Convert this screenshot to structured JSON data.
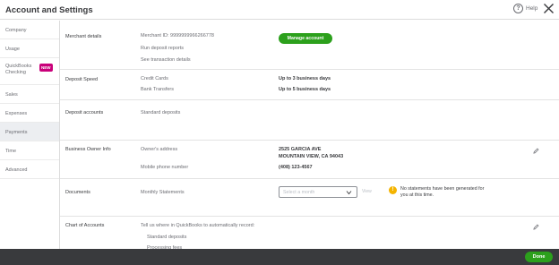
{
  "header": {
    "title": "Account and Settings",
    "help_label": "Help"
  },
  "sidebar": {
    "items": [
      {
        "label": "Company"
      },
      {
        "label": "Usage"
      },
      {
        "label": "QuickBooks Checking",
        "badge": "NEW"
      },
      {
        "label": "Sales"
      },
      {
        "label": "Expenses"
      },
      {
        "label": "Payments",
        "active": true
      },
      {
        "label": "Time"
      },
      {
        "label": "Advanced"
      }
    ]
  },
  "sections": {
    "merchant": {
      "title": "Merchant details",
      "merchant_id": "Merchant ID: 9999999966266778",
      "run_reports": "Run deposit reports",
      "see_details": "See transaction details",
      "manage_label": "Manage account"
    },
    "deposit_speed": {
      "title": "Deposit Speed",
      "rows": [
        {
          "label": "Credit Cards",
          "value": "Up to 3 business days"
        },
        {
          "label": "Bank Transfers",
          "value": "Up to 5 business days"
        }
      ]
    },
    "deposit_accounts": {
      "title": "Deposit accounts",
      "label": "Standard deposits"
    },
    "owner": {
      "title": "Business Owner Info",
      "address_label": "Owner's address",
      "address_line1": "2525 GARCIA AVE",
      "address_line2": "MOUNTAIN VIEW, CA 94043",
      "phone_label": "Mobile phone number",
      "phone": "(408) 123-4567"
    },
    "documents": {
      "title": "Documents",
      "label": "Monthly Statements",
      "select_placeholder": "Select a month",
      "view_label": "View",
      "notice": "No statements have been generated for you at this time."
    },
    "chart_accounts": {
      "title": "Chart of Accounts",
      "intro": "Tell us where in QuickBooks to automatically record:",
      "items": [
        "Standard deposits",
        "Processing fees"
      ]
    }
  },
  "footer": {
    "done_label": "Done"
  },
  "colors": {
    "accent": "#2ca01c",
    "badge": "#c9007a",
    "warning": "#f4b400",
    "footer": "#393a3d"
  }
}
